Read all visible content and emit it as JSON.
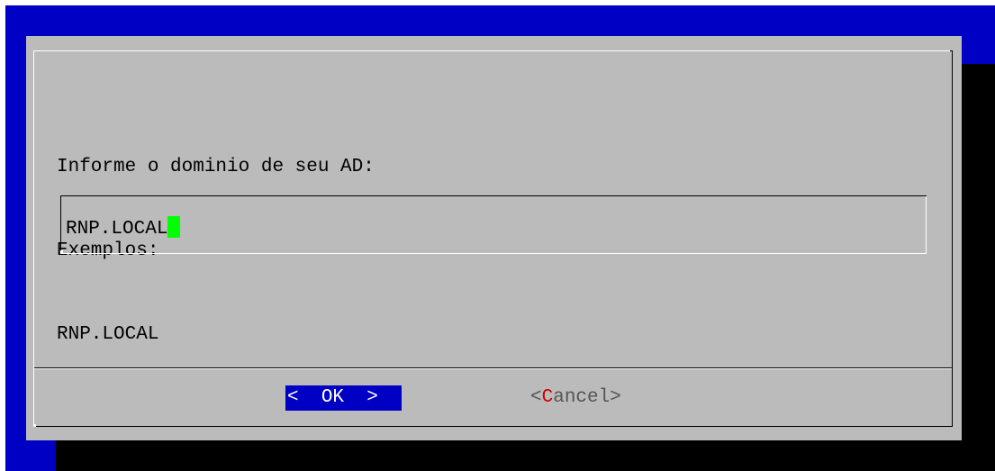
{
  "dialog": {
    "prompt_lines": [
      "Informe o dominio de seu AD:",
      "Exemplos:",
      "RNP.LOCAL"
    ],
    "input": {
      "value": "RNP.LOCAL"
    },
    "buttons": {
      "ok": {
        "left_bracket": "<",
        "label": "OK",
        "right_bracket": ">"
      },
      "cancel": {
        "left_bracket": "<",
        "hotkey": "C",
        "label_rest": "ancel",
        "right_bracket": ">"
      }
    }
  },
  "colors": {
    "screen_background": "#0000c4",
    "dialog_background": "#bbbbbb",
    "cursor": "#00ff00",
    "selected_button_background": "#0000c4",
    "hotkey": "#cc0000"
  }
}
